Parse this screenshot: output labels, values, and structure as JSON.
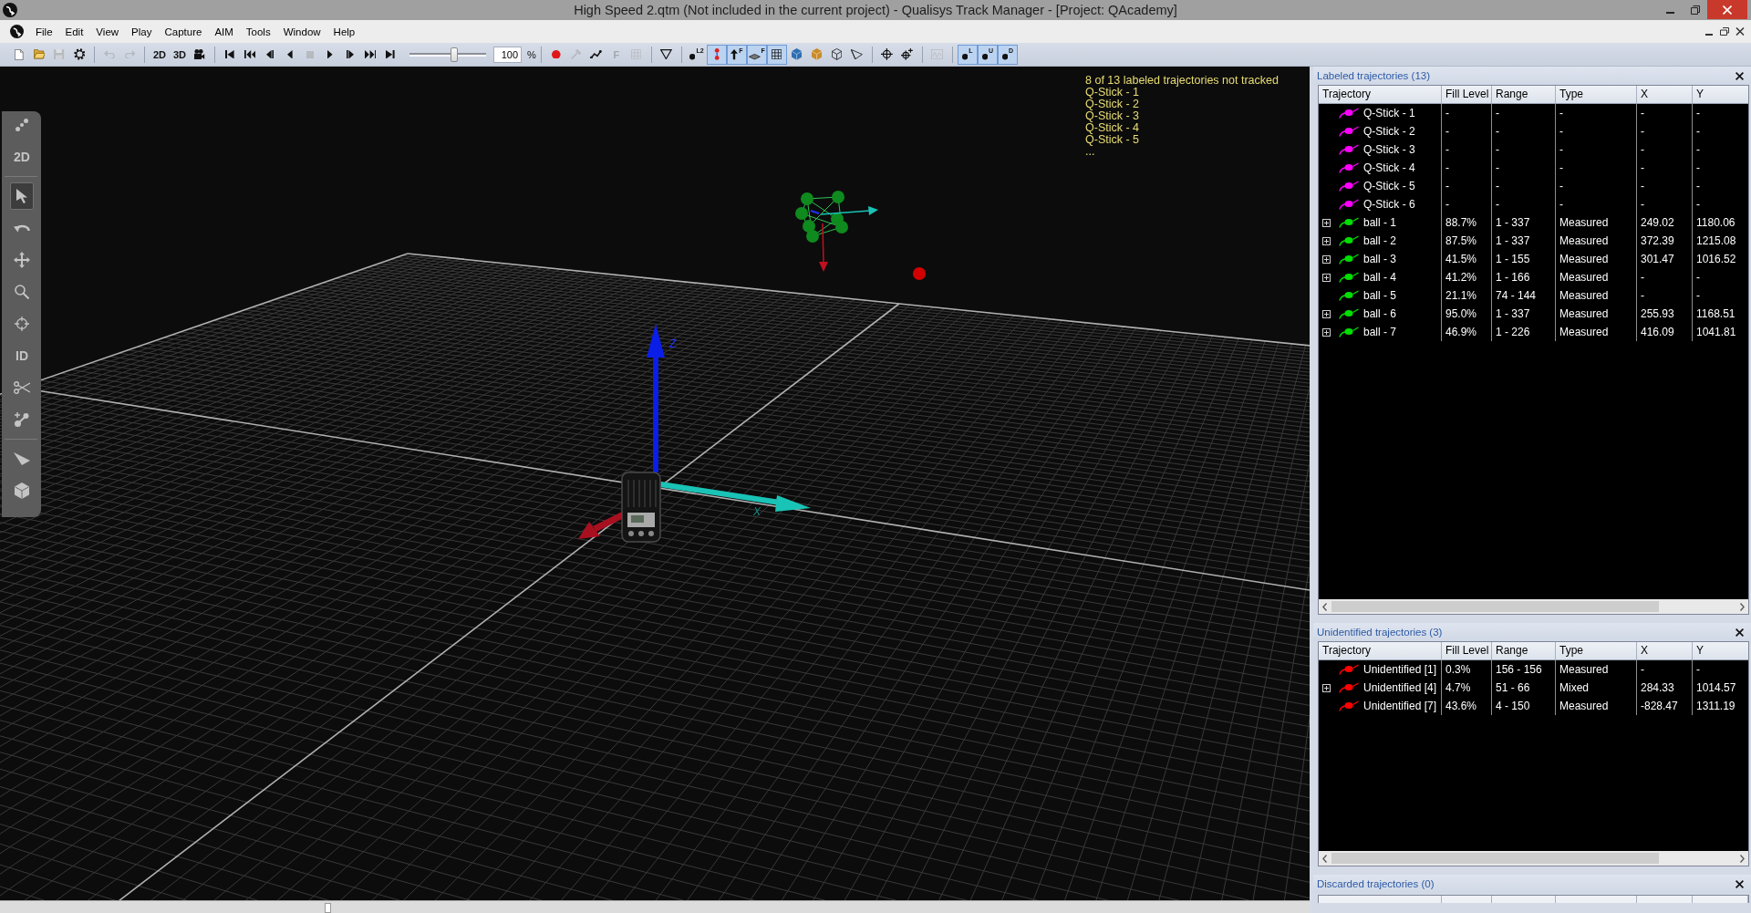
{
  "window": {
    "title": "High Speed 2.qtm (Not included in the current project) - Qualisys Track Manager - [Project: QAcademy]"
  },
  "menu": [
    "File",
    "Edit",
    "View",
    "Play",
    "Capture",
    "AIM",
    "Tools",
    "Window",
    "Help"
  ],
  "toolbar": {
    "groups": [
      {
        "items": [
          {
            "kind": "button",
            "disabled": false,
            "pressed": false
          },
          {
            "kind": "button",
            "disabled": false,
            "pressed": false
          },
          {
            "kind": "button",
            "disabled": true,
            "pressed": false
          },
          {
            "kind": "button",
            "disabled": false,
            "pressed": false
          }
        ]
      },
      {
        "items": [
          {
            "kind": "button",
            "disabled": true,
            "pressed": false
          },
          {
            "kind": "button",
            "disabled": true,
            "pressed": false
          }
        ]
      },
      {
        "items": [
          {
            "kind": "text",
            "label": "2D",
            "disabled": false,
            "pressed": false
          },
          {
            "kind": "text",
            "label": "3D",
            "disabled": false,
            "pressed": false
          },
          {
            "kind": "button",
            "disabled": false,
            "pressed": false
          }
        ]
      },
      {
        "items": [
          {
            "kind": "button",
            "disabled": false,
            "pressed": false
          },
          {
            "kind": "button",
            "disabled": false,
            "pressed": false
          },
          {
            "kind": "button",
            "disabled": false,
            "pressed": false
          },
          {
            "kind": "button",
            "disabled": false,
            "pressed": false
          },
          {
            "kind": "button",
            "disabled": true,
            "pressed": false
          },
          {
            "kind": "button",
            "disabled": false,
            "pressed": false
          },
          {
            "kind": "button",
            "disabled": false,
            "pressed": false
          },
          {
            "kind": "button",
            "disabled": false,
            "pressed": false
          },
          {
            "kind": "button",
            "disabled": false,
            "pressed": false
          },
          {
            "kind": "slider",
            "level": 0.58
          },
          {
            "kind": "field",
            "value": "100"
          },
          {
            "kind": "label",
            "text": "%"
          }
        ]
      },
      {
        "items": [
          {
            "kind": "button",
            "disabled": false,
            "pressed": false
          },
          {
            "kind": "button",
            "disabled": true,
            "pressed": false
          },
          {
            "kind": "button",
            "disabled": false,
            "pressed": false
          },
          {
            "kind": "text",
            "label": "F",
            "disabled": true,
            "pressed": false
          },
          {
            "kind": "button",
            "disabled": true,
            "pressed": false
          }
        ]
      },
      {
        "items": [
          {
            "kind": "button",
            "disabled": false,
            "pressed": false
          }
        ]
      },
      {
        "items": [
          {
            "kind": "badge",
            "label": "L2",
            "disabled": false,
            "pressed": false
          },
          {
            "kind": "button",
            "disabled": false,
            "pressed": true
          },
          {
            "kind": "badge",
            "label": "F",
            "disabled": false,
            "pressed": true
          },
          {
            "kind": "badge",
            "label": "F",
            "disabled": false,
            "pressed": true
          },
          {
            "kind": "button",
            "disabled": false,
            "pressed": true
          },
          {
            "kind": "button",
            "disabled": false,
            "pressed": false
          },
          {
            "kind": "button",
            "disabled": false,
            "pressed": false
          },
          {
            "kind": "button",
            "disabled": false,
            "pressed": false
          },
          {
            "kind": "button",
            "disabled": false,
            "pressed": false
          }
        ]
      },
      {
        "items": [
          {
            "kind": "button",
            "disabled": false,
            "pressed": false
          },
          {
            "kind": "button",
            "disabled": false,
            "pressed": false
          }
        ]
      },
      {
        "items": [
          {
            "kind": "button",
            "disabled": true,
            "pressed": false
          }
        ]
      },
      {
        "items": [
          {
            "kind": "badge",
            "label": "L",
            "disabled": false,
            "pressed": true
          },
          {
            "kind": "badge",
            "label": "U",
            "disabled": false,
            "pressed": true
          },
          {
            "kind": "badge",
            "label": "D",
            "disabled": false,
            "pressed": true
          }
        ]
      }
    ]
  },
  "view_tools": {
    "groups": [
      {
        "tools": [
          {
            "kind": "icon",
            "selected": false
          },
          {
            "kind": "text",
            "label": "2D",
            "selected": false
          }
        ]
      },
      {
        "tools": [
          {
            "kind": "icon",
            "selected": true
          },
          {
            "kind": "icon",
            "selected": false
          },
          {
            "kind": "icon",
            "selected": false
          },
          {
            "kind": "icon",
            "selected": false
          },
          {
            "kind": "icon",
            "selected": false
          },
          {
            "kind": "text",
            "label": "ID",
            "selected": false
          },
          {
            "kind": "icon",
            "selected": false
          },
          {
            "kind": "icon",
            "selected": false
          }
        ]
      },
      {
        "tools": [
          {
            "kind": "icon",
            "selected": false
          },
          {
            "kind": "icon",
            "selected": false
          }
        ]
      }
    ]
  },
  "viewport": {
    "overlay": {
      "message": "8 of 13 labeled trajectories not tracked",
      "items": [
        "Q-Stick - 1",
        "Q-Stick - 2",
        "Q-Stick - 3",
        "Q-Stick - 4",
        "Q-Stick - 5"
      ],
      "more": "..."
    },
    "axis_labels": [
      "Z",
      "X"
    ]
  },
  "timeline": {
    "level": 0.25
  },
  "panels": [
    {
      "title": "Labeled trajectories (13)",
      "columns": [
        "Trajectory",
        "Fill Level",
        "Range",
        "Type",
        "X",
        "Y"
      ],
      "rows": [
        {
          "expandable": false,
          "color": "#ff00ff",
          "cells": [
            "Q-Stick - 1",
            "-",
            "-",
            "-",
            "-",
            "-"
          ]
        },
        {
          "expandable": false,
          "color": "#ff00ff",
          "cells": [
            "Q-Stick - 2",
            "-",
            "-",
            "-",
            "-",
            "-"
          ]
        },
        {
          "expandable": false,
          "color": "#ff00ff",
          "cells": [
            "Q-Stick - 3",
            "-",
            "-",
            "-",
            "-",
            "-"
          ]
        },
        {
          "expandable": false,
          "color": "#ff00ff",
          "cells": [
            "Q-Stick - 4",
            "-",
            "-",
            "-",
            "-",
            "-"
          ]
        },
        {
          "expandable": false,
          "color": "#ff00ff",
          "cells": [
            "Q-Stick - 5",
            "-",
            "-",
            "-",
            "-",
            "-"
          ]
        },
        {
          "expandable": false,
          "color": "#ff00ff",
          "cells": [
            "Q-Stick - 6",
            "-",
            "-",
            "-",
            "-",
            "-"
          ]
        },
        {
          "expandable": true,
          "color": "#00e000",
          "cells": [
            "ball - 1",
            "88.7%",
            "1 - 337",
            "Measured",
            "249.02",
            "1180.06"
          ]
        },
        {
          "expandable": true,
          "color": "#00e000",
          "cells": [
            "ball - 2",
            "87.5%",
            "1 - 337",
            "Measured",
            "372.39",
            "1215.08"
          ]
        },
        {
          "expandable": true,
          "color": "#00e000",
          "cells": [
            "ball - 3",
            "41.5%",
            "1 - 155",
            "Measured",
            "301.47",
            "1016.52"
          ]
        },
        {
          "expandable": true,
          "color": "#00e000",
          "cells": [
            "ball - 4",
            "41.2%",
            "1 - 166",
            "Measured",
            "-",
            "-"
          ]
        },
        {
          "expandable": false,
          "color": "#00e000",
          "cells": [
            "ball - 5",
            "21.1%",
            "74 - 144",
            "Measured",
            "-",
            "-"
          ]
        },
        {
          "expandable": true,
          "color": "#00e000",
          "cells": [
            "ball - 6",
            "95.0%",
            "1 - 337",
            "Measured",
            "255.93",
            "1168.51"
          ]
        },
        {
          "expandable": true,
          "color": "#00e000",
          "cells": [
            "ball - 7",
            "46.9%",
            "1 - 226",
            "Measured",
            "416.09",
            "1041.81"
          ]
        }
      ]
    },
    {
      "title": "Unidentified trajectories (3)",
      "columns": [
        "Trajectory",
        "Fill Level",
        "Range",
        "Type",
        "X",
        "Y"
      ],
      "rows": [
        {
          "expandable": false,
          "color": "#ff0000",
          "cells": [
            "Unidentified [1]",
            "0.3%",
            "156 - 156",
            "Measured",
            "-",
            "-"
          ]
        },
        {
          "expandable": true,
          "color": "#ff0000",
          "cells": [
            "Unidentified [4]",
            "4.7%",
            "51 - 66",
            "Mixed",
            "284.33",
            "1014.57"
          ]
        },
        {
          "expandable": false,
          "color": "#ff0000",
          "cells": [
            "Unidentified [7]",
            "43.6%",
            "4 - 150",
            "Measured",
            "-828.47",
            "1311.19"
          ]
        }
      ]
    },
    {
      "title": "Discarded trajectories (0)"
    }
  ]
}
